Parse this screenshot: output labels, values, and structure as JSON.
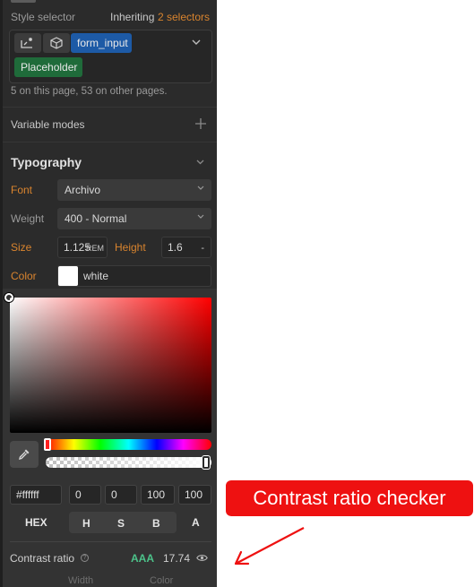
{
  "style_selector": {
    "label": "Style selector",
    "inheriting_prefix": "Inheriting",
    "inheriting_count": "2 selectors",
    "chips": [
      "form_input",
      "Placeholder"
    ],
    "usage_note": "5 on this page, 53 on other pages."
  },
  "variable_modes": {
    "label": "Variable modes",
    "add_symbol": "+"
  },
  "typography": {
    "title": "Typography",
    "font_label": "Font",
    "font_value": "Archivo",
    "weight_label": "Weight",
    "weight_value": "400 - Normal",
    "size_label": "Size",
    "size_value": "1.125",
    "size_unit": "REM",
    "height_label": "Height",
    "height_value": "1.6",
    "height_unit": "-",
    "color_label": "Color",
    "color_value": "white"
  },
  "picker": {
    "hex_value": "#ffffff",
    "h": "0",
    "s": "0",
    "b": "100",
    "a": "100",
    "modes": {
      "hex": "HEX",
      "h": "H",
      "s": "S",
      "b": "B",
      "a": "A"
    },
    "contrast_label": "Contrast ratio",
    "contrast_help": "?",
    "contrast_grade": "AAA",
    "contrast_value": "17.74",
    "contrast_level": 17.74
  },
  "footer_cols": [
    "Width",
    "Color"
  ],
  "annotation": {
    "text": "Contrast ratio checker"
  },
  "colors": {
    "panel": "#2b2b2b",
    "accent_orange": "#d9842e",
    "chip_blue": "#1d5aa6",
    "chip_green": "#1f6b3a",
    "grade_green": "#4cc38a",
    "callout_red": "#ee1111"
  }
}
